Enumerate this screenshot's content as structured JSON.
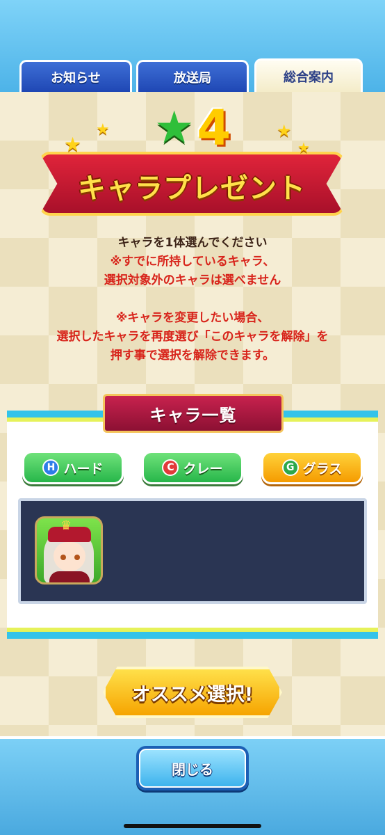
{
  "tabs": [
    {
      "label": "お知らせ",
      "active": false
    },
    {
      "label": "放送局",
      "active": false
    },
    {
      "label": "総合案内",
      "active": true
    }
  ],
  "banner": {
    "rank": "4",
    "title": "キャラプレゼント"
  },
  "instructions": {
    "line1": "キャラを1体選んでください",
    "line2": "※すでに所持しているキャラ、",
    "line3": "選択対象外のキャラは選べません",
    "line4": "※キャラを変更したい場合、",
    "line5": "選択したキャラを再度選び「このキャラを解除」を",
    "line6": "押す事で選択を解除できます。"
  },
  "list": {
    "title": "キャラ一覧",
    "filters": [
      {
        "badge": "H",
        "label": "ハード",
        "selected": false
      },
      {
        "badge": "C",
        "label": "クレー",
        "selected": false
      },
      {
        "badge": "G",
        "label": "グラス",
        "selected": true
      }
    ]
  },
  "buttons": {
    "recommend": "オススメ選択!",
    "close": "閉じる"
  },
  "colors": {
    "accent_blue": "#33c3ea",
    "banner_red": "#c8224e",
    "selected_filter": "#f59b00"
  }
}
